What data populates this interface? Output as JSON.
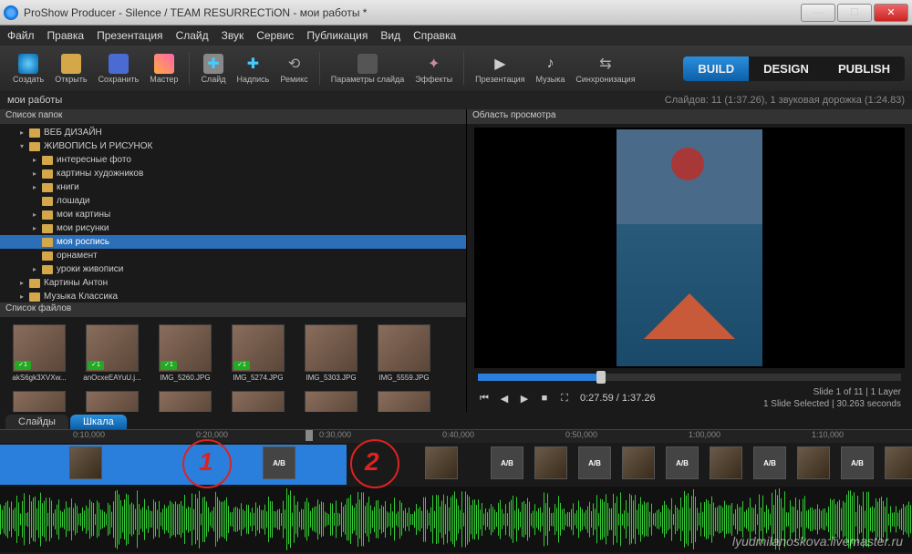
{
  "titlebar": {
    "text": "ProShow Producer - Silence / TEAM RESURRECTiON - мои работы *"
  },
  "menu": [
    "Файл",
    "Правка",
    "Презентация",
    "Слайд",
    "Звук",
    "Сервис",
    "Публикация",
    "Вид",
    "Справка"
  ],
  "toolbar": {
    "items": [
      {
        "label": "Создать",
        "icon": "new"
      },
      {
        "label": "Открыть",
        "icon": "open"
      },
      {
        "label": "Сохранить",
        "icon": "save"
      },
      {
        "label": "Мастер",
        "icon": "wizard"
      },
      {
        "label": "Слайд",
        "icon": "slide"
      },
      {
        "label": "Надпись",
        "icon": "text"
      },
      {
        "label": "Ремикс",
        "icon": "remix"
      },
      {
        "label": "Параметры слайда",
        "icon": "options"
      },
      {
        "label": "Эффекты",
        "icon": "fx"
      },
      {
        "label": "Презентация",
        "icon": "play"
      },
      {
        "label": "Музыка",
        "icon": "music"
      },
      {
        "label": "Синхронизация",
        "icon": "sync"
      }
    ]
  },
  "modes": {
    "build": "BUILD",
    "design": "DESIGN",
    "publish": "PUBLISH"
  },
  "project": {
    "name": "мои работы",
    "info": "Слайдов: 11 (1:37.26), 1 звуковая дорожка (1:24.83)"
  },
  "panels": {
    "folders": "Список папок",
    "files": "Список файлов",
    "preview": "Область просмотра"
  },
  "tree": [
    {
      "label": "ВЕБ ДИЗАЙН",
      "indent": 1,
      "exp": "▸"
    },
    {
      "label": "ЖИВОПИСЬ И РИСУНОК",
      "indent": 1,
      "exp": "▾"
    },
    {
      "label": "интересные фото",
      "indent": 2,
      "exp": "▸"
    },
    {
      "label": "картины художников",
      "indent": 2,
      "exp": "▸"
    },
    {
      "label": "книги",
      "indent": 2,
      "exp": "▸"
    },
    {
      "label": "лошади",
      "indent": 2,
      "exp": ""
    },
    {
      "label": "мои картины",
      "indent": 2,
      "exp": "▸"
    },
    {
      "label": "мои рисунки",
      "indent": 2,
      "exp": "▸"
    },
    {
      "label": "моя роспись",
      "indent": 2,
      "exp": "",
      "sel": true
    },
    {
      "label": "орнамент",
      "indent": 2,
      "exp": ""
    },
    {
      "label": "уроки живописи",
      "indent": 2,
      "exp": "▸"
    },
    {
      "label": "Картины Антон",
      "indent": 1,
      "exp": "▸"
    },
    {
      "label": "Музыка Классика",
      "indent": 1,
      "exp": "▸"
    }
  ],
  "files": [
    {
      "name": "akS6gk3XVXw...",
      "badge": "1"
    },
    {
      "name": "anOcxeEAYuU.j...",
      "badge": "1"
    },
    {
      "name": "IMG_5260.JPG",
      "badge": "1"
    },
    {
      "name": "IMG_5274.JPG",
      "badge": "1"
    },
    {
      "name": "IMG_5303.JPG",
      "badge": ""
    },
    {
      "name": "IMG_5559.JPG",
      "badge": ""
    }
  ],
  "playback": {
    "time": "0:27.59 / 1:37.26",
    "info1": "Slide 1 of 11  |  1 Layer",
    "info2": "1 Slide Selected  |  30.263 seconds"
  },
  "tabs": {
    "slides": "Слайды",
    "scale": "Шкала"
  },
  "ruler": [
    "0:10,000",
    "0:20,000",
    "0:30,000",
    "0:40,000",
    "0:50,000",
    "1:00,000",
    "1:10,000"
  ],
  "annotations": {
    "one": "1",
    "two": "2"
  },
  "watermark": "lyudmilanoskova:livemaster.ru"
}
